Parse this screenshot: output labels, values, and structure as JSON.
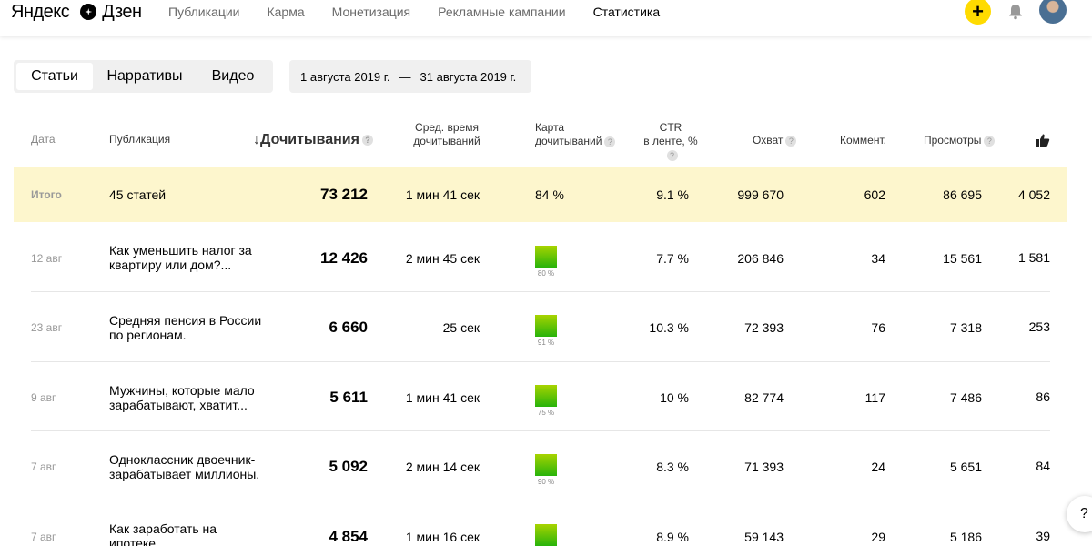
{
  "header": {
    "logo_left": "Яндекс",
    "logo_right": "Дзен",
    "nav": [
      "Публикации",
      "Карма",
      "Монетизация",
      "Рекламные кампании",
      "Статистика"
    ],
    "add_label": "+"
  },
  "tabs": [
    "Статьи",
    "Нарративы",
    "Видео"
  ],
  "daterange": {
    "from": "1 августа 2019 г.",
    "dash": "—",
    "to": "31 августа 2019 г."
  },
  "columns": {
    "date": "Дата",
    "publication": "Публикация",
    "reads": "↓Дочитывания",
    "avg_time_1": "Сред. время",
    "avg_time_2": "дочитываний",
    "map_1": "Карта",
    "map_2": "дочитываний",
    "ctr_1": "CTR",
    "ctr_2": "в ленте, %",
    "reach": "Охват",
    "comments": "Коммент.",
    "views": "Просмотры",
    "help_mark": "?"
  },
  "total": {
    "label": "Итого",
    "publication": "45 статей",
    "reads": "73 212",
    "avg_time": "1 мин 41 сек",
    "map": "84 %",
    "ctr": "9.1 %",
    "reach": "999 670",
    "comments": "602",
    "views": "86 695",
    "likes": "4 052"
  },
  "rows": [
    {
      "date": "12 авг",
      "title": "Как уменьшить налог за квартиру или дом?...",
      "reads": "12 426",
      "avg_time": "2 мин 45 сек",
      "map": "80 %",
      "ctr": "7.7 %",
      "reach": "206 846",
      "comments": "34",
      "views": "15 561",
      "likes": "1 581"
    },
    {
      "date": "23 авг",
      "title": "Средняя пенсия в России по регионам.",
      "reads": "6 660",
      "avg_time": "25 сек",
      "map": "91 %",
      "ctr": "10.3 %",
      "reach": "72 393",
      "comments": "76",
      "views": "7 318",
      "likes": "253"
    },
    {
      "date": "9 авг",
      "title": "Мужчины, которые мало зарабатывают, хватит...",
      "reads": "5 611",
      "avg_time": "1 мин 41 сек",
      "map": "75 %",
      "ctr": "10 %",
      "reach": "82 774",
      "comments": "117",
      "views": "7 486",
      "likes": "86"
    },
    {
      "date": "7 авг",
      "title": "Одноклассник двоечник-зарабатывает миллионы.",
      "reads": "5 092",
      "avg_time": "2 мин 14 сек",
      "map": "90 %",
      "ctr": "8.3 %",
      "reach": "71 393",
      "comments": "24",
      "views": "5 651",
      "likes": "84"
    },
    {
      "date": "7 авг",
      "title": "Как заработать на ипотеке",
      "reads": "4 854",
      "avg_time": "1 мин 16 сек",
      "map": "",
      "ctr": "8.9 %",
      "reach": "59 143",
      "comments": "29",
      "views": "5 186",
      "likes": "39"
    }
  ],
  "help_button": "?",
  "colors": {
    "accent": "#ffdb00",
    "total_row_bg": "#fdf6cd",
    "heat_top": "#a8d400",
    "heat_bottom": "#28b30b"
  }
}
